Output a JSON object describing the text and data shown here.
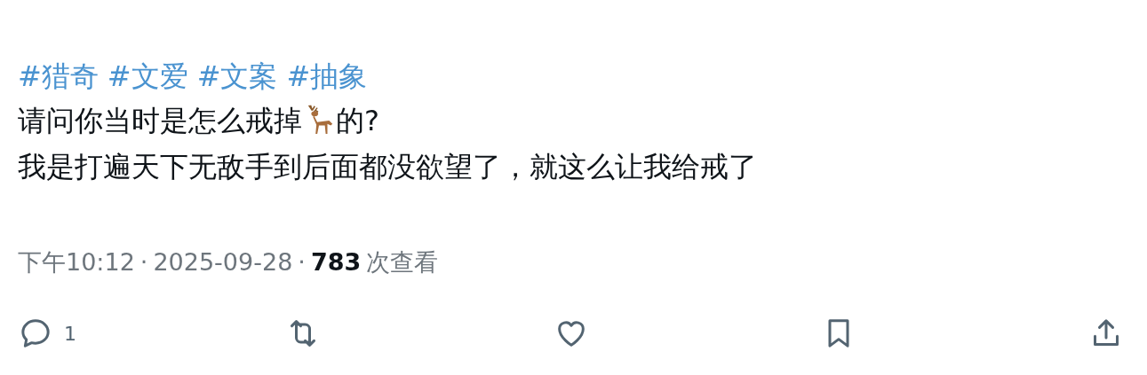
{
  "hashtags": [
    "#猎奇",
    "#文爱",
    "#文案",
    "#抽象"
  ],
  "lines": [
    [
      {
        "kind": "text",
        "text": "请问你当时是怎么戒掉"
      },
      {
        "kind": "emoji"
      },
      {
        "kind": "text",
        "text": "的?"
      }
    ],
    [
      {
        "kind": "text",
        "text": "我是打遍天下无敌手到后面都没欲望了，就这么让我给戒了"
      }
    ]
  ],
  "meta": {
    "time": "下午10:12",
    "separator_1": "·",
    "date": "2025-09-28",
    "separator_2": "·",
    "views": "783",
    "views_label": "次查看"
  },
  "actions": [
    {
      "kind": "reply",
      "count": "1"
    },
    {
      "kind": "repost"
    },
    {
      "kind": "like"
    },
    {
      "kind": "bookmark"
    },
    {
      "kind": "share"
    }
  ]
}
